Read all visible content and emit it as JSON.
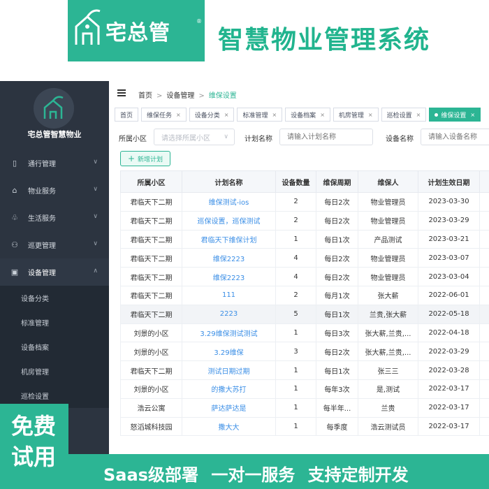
{
  "banner": {
    "logo_text": "宅总管",
    "logo_reg": "®",
    "title": "智慧物业管理系统"
  },
  "sidebar": {
    "brand": "宅总管智慧物业",
    "items": [
      {
        "label": "通行管理",
        "icon": "door-icon"
      },
      {
        "label": "物业服务",
        "icon": "home-service-icon"
      },
      {
        "label": "生活服务",
        "icon": "plant-icon"
      },
      {
        "label": "巡更管理",
        "icon": "patrol-icon"
      },
      {
        "label": "设备管理",
        "icon": "equipment-icon"
      }
    ],
    "subitems": [
      "设备分类",
      "标准管理",
      "设备档案",
      "机房管理",
      "巡检设置"
    ]
  },
  "promo": {
    "trial": "免费试用",
    "bottom": "Saas级部署 一对一服务 支持定制开发"
  },
  "breadcrumb": {
    "home": "首页",
    "section": "设备管理",
    "current": "维保设置"
  },
  "tabs": [
    "首页",
    "维保任务",
    "设备分类",
    "标准管理",
    "设备档案",
    "机房管理",
    "巡检设置",
    "维保设置"
  ],
  "filters": {
    "community_label": "所属小区",
    "community_placeholder": "请选择所属小区",
    "plan_label": "计划名称",
    "plan_placeholder": "请输入计划名称",
    "device_label": "设备名称",
    "device_placeholder": "请输入设备名称"
  },
  "add_button": "新增计划",
  "table": {
    "headers": [
      "所属小区",
      "计划名称",
      "设备数量",
      "维保周期",
      "维保人",
      "计划生效日期"
    ],
    "rows": [
      [
        "君临天下二期",
        "维保测试-ios",
        "2",
        "每日2次",
        "物业管理员",
        "2023-03-30"
      ],
      [
        "君临天下二期",
        "巡保设置，巡保测试",
        "2",
        "每日2次",
        "物业管理员",
        "2023-03-29"
      ],
      [
        "君临天下二期",
        "君临天下维保计划",
        "1",
        "每日1次",
        "产品测试",
        "2023-03-21"
      ],
      [
        "君临天下二期",
        "维保2223",
        "4",
        "每日2次",
        "物业管理员",
        "2023-03-07"
      ],
      [
        "君临天下二期",
        "维保2223",
        "4",
        "每日2次",
        "物业管理员",
        "2023-03-04"
      ],
      [
        "君临天下二期",
        "111",
        "2",
        "每月1次",
        "张大薪",
        "2022-06-01"
      ],
      [
        "君临天下二期",
        "2223",
        "5",
        "每日1次",
        "兰贵,张大薪",
        "2022-05-18"
      ],
      [
        "刘景的小区",
        "3.29维保测试测试",
        "1",
        "每日3次",
        "张大薪,兰贵,...",
        "2022-04-18"
      ],
      [
        "刘景的小区",
        "3.29维保",
        "3",
        "每日2次",
        "张大薪,兰贵,...",
        "2022-03-29"
      ],
      [
        "君临天下二期",
        "测试日期过期",
        "1",
        "每日1次",
        "张三三",
        "2022-03-28"
      ],
      [
        "刘景的小区",
        "的撒大苏打",
        "1",
        "每年3次",
        "是,测试",
        "2022-03-17"
      ],
      [
        "浩云公寓",
        "萨达萨达是",
        "1",
        "每半年...",
        "兰贵",
        "2022-03-17"
      ],
      [
        "怒滔城科技园",
        "撒大大",
        "1",
        "每季度",
        "浩云测试员",
        "2022-03-17"
      ]
    ]
  },
  "colors": {
    "brand": "#2cb594",
    "sidebar": "#2c3440",
    "link": "#3a8ee6"
  }
}
